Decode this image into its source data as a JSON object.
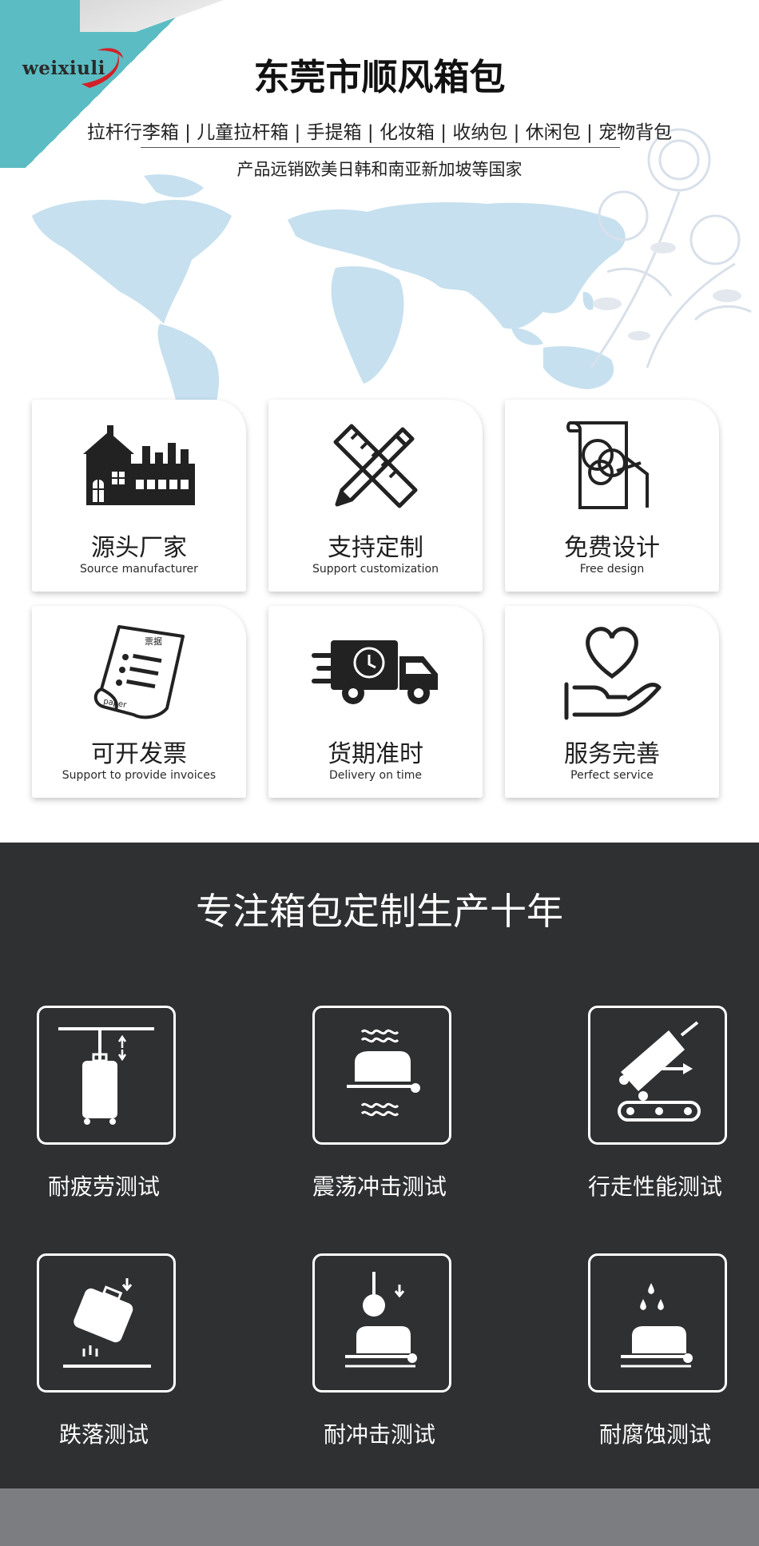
{
  "logo": {
    "text": "weixiuli"
  },
  "header": {
    "title": "东莞市顺风箱包",
    "categories": "拉杆行李箱 | 儿童拉杆箱 | 手提箱 | 化妆箱 | 收纳包 | 休闲包 | 宠物背包",
    "export_note": "产品远销欧美日韩和南亚新加坡等国家"
  },
  "features": [
    {
      "cn": "源头厂家",
      "en": "Source  manufacturer",
      "icon": "factory-icon"
    },
    {
      "cn": "支持定制",
      "en": "Support customization",
      "icon": "pencil-ruler-icon"
    },
    {
      "cn": "免费设计",
      "en": "Free design",
      "icon": "drawing-board-icon"
    },
    {
      "cn": "可开发票",
      "en": "Support to provide invoices",
      "icon": "invoice-paper-icon",
      "paper_label": "票据",
      "paper_caption": "paper"
    },
    {
      "cn": "货期准时",
      "en": "Delivery on time",
      "icon": "delivery-truck-icon"
    },
    {
      "cn": "服务完善",
      "en": "Perfect service",
      "icon": "heart-hand-icon"
    }
  ],
  "testing": {
    "title": "专注箱包定制生产十年",
    "tests": [
      {
        "label": "耐疲劳测试",
        "icon": "fatigue-test-icon"
      },
      {
        "label": "震荡冲击测试",
        "icon": "vibration-test-icon"
      },
      {
        "label": "行走性能测试",
        "icon": "walking-test-icon"
      },
      {
        "label": "跌落测试",
        "icon": "drop-test-icon"
      },
      {
        "label": "耐冲击测试",
        "icon": "impact-test-icon"
      },
      {
        "label": "耐腐蚀测试",
        "icon": "corrosion-test-icon"
      }
    ]
  },
  "colors": {
    "teal": "#5bbcc3",
    "dark_bg": "#2f3032",
    "bottom_bar": "#7c7d80",
    "map_blue": "#c6e0ef"
  }
}
